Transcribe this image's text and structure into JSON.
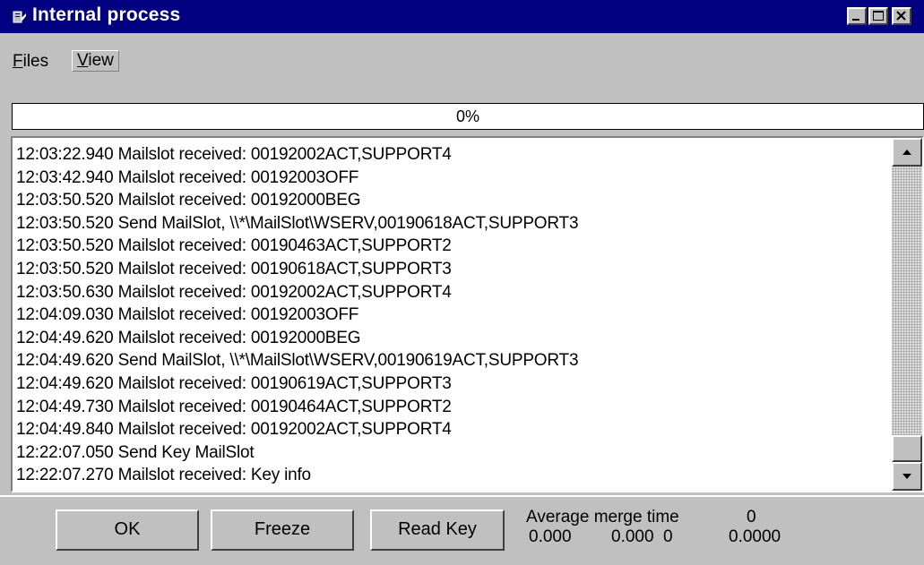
{
  "window": {
    "title": "Internal process",
    "icon": "app-icon",
    "controls": [
      "minimize-icon",
      "maximize-icon",
      "close-icon"
    ]
  },
  "menu": {
    "files_label": "Files",
    "files_accel": "F",
    "files_rest": "iles",
    "view_label": "View",
    "view_accel": "V",
    "view_rest": "iew"
  },
  "progress": {
    "label": "0%",
    "value": 0
  },
  "log": {
    "lines": [
      "12:03:22.940 Mailslot received: 00192002ACT,SUPPORT4",
      "12:03:42.940 Mailslot received: 00192003OFF",
      "12:03:50.520 Mailslot received: 00192000BEG",
      "12:03:50.520 Send MailSlot, \\\\*\\MailSlot\\WSERV,00190618ACT,SUPPORT3",
      "12:03:50.520 Mailslot received: 00190463ACT,SUPPORT2",
      "12:03:50.520 Mailslot received: 00190618ACT,SUPPORT3",
      "12:03:50.630 Mailslot received: 00192002ACT,SUPPORT4",
      "12:04:09.030 Mailslot received: 00192003OFF",
      "12:04:49.620 Mailslot received: 00192000BEG",
      "12:04:49.620 Send MailSlot, \\\\*\\MailSlot\\WSERV,00190619ACT,SUPPORT3",
      "12:04:49.620 Mailslot received: 00190619ACT,SUPPORT3",
      "12:04:49.730 Mailslot received: 00190464ACT,SUPPORT2",
      "12:04:49.840 Mailslot received: 00192002ACT,SUPPORT4",
      "12:22:07.050 Send Key MailSlot",
      "12:22:07.270 Mailslot received: Key info"
    ]
  },
  "buttons": {
    "ok": "OK",
    "freeze": "Freeze",
    "read_key": "Read Key"
  },
  "stats": {
    "average_label": "Average merge time",
    "average_value": "0",
    "v1": "0.000",
    "v2": "0.000",
    "v3": "0",
    "v4": "0.0000"
  }
}
